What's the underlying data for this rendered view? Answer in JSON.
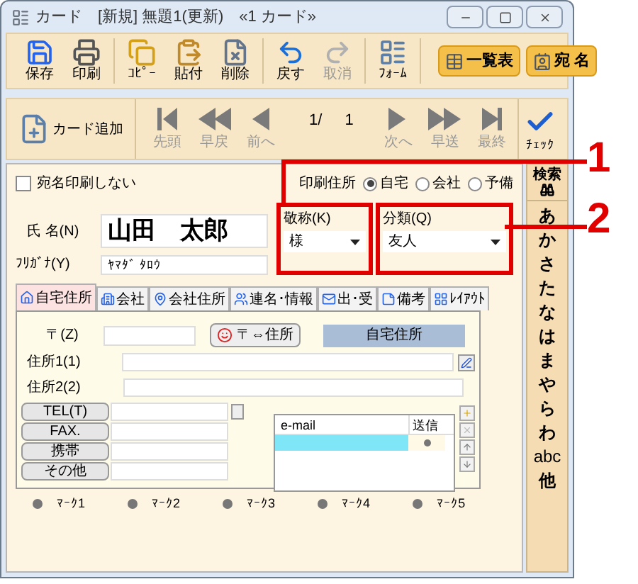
{
  "window": {
    "title": "カード　[新規] 無題1(更新)　«1 カード»"
  },
  "toolbar": {
    "groups": [
      {
        "buttons": [
          {
            "label": "保存",
            "disabled": false
          },
          {
            "label": "印刷",
            "disabled": false
          }
        ]
      },
      {
        "buttons": [
          {
            "label": "ｺﾋﾟｰ",
            "disabled": false
          },
          {
            "label": "貼付",
            "disabled": false
          },
          {
            "label": "削除",
            "disabled": false
          }
        ]
      },
      {
        "buttons": [
          {
            "label": "戻す",
            "disabled": false
          },
          {
            "label": "取消",
            "disabled": true
          }
        ]
      },
      {
        "buttons": [
          {
            "label": "ﾌｫｰﾑ",
            "disabled": false
          }
        ]
      }
    ],
    "wide_buttons": [
      {
        "label": "一覧表"
      },
      {
        "label": "宛 名"
      }
    ]
  },
  "nav": {
    "add_label": "カード追加",
    "back": [
      {
        "label": "先頭",
        "disabled": true
      },
      {
        "label": "早戻",
        "disabled": true
      },
      {
        "label": "前へ",
        "disabled": true
      }
    ],
    "current": "1/",
    "total": "1",
    "forward": [
      {
        "label": "次へ",
        "disabled": true
      },
      {
        "label": "早送",
        "disabled": true
      },
      {
        "label": "最終",
        "disabled": true
      }
    ],
    "check_label": "ﾁｪｯｸ"
  },
  "header": {
    "no_address_print": {
      "label": "宛名印刷しない",
      "checked": false
    },
    "print_address": {
      "label": "印刷住所",
      "options": [
        {
          "label": "自宅",
          "selected": true
        },
        {
          "label": "会社",
          "selected": false
        },
        {
          "label": "予備",
          "selected": false
        }
      ]
    }
  },
  "name": {
    "label": "氏 名(N)",
    "value": "山田　太郎"
  },
  "furigana": {
    "label": "ﾌﾘｶﾞﾅ(Y)",
    "value": "ﾔﾏﾀﾞ ﾀﾛｳ"
  },
  "honorific": {
    "label": "敬称(K)",
    "value": "様"
  },
  "category": {
    "label": "分類(Q)",
    "value": "友人"
  },
  "tabs": [
    {
      "label": "自宅住所",
      "selected": true
    },
    {
      "label": "会社",
      "selected": false
    },
    {
      "label": "会社住所",
      "selected": false
    },
    {
      "label": "連名･情報",
      "selected": false
    },
    {
      "label": "出･受",
      "selected": false
    },
    {
      "label": "備考",
      "selected": false
    },
    {
      "label": "ﾚｲｱｳﾄ",
      "selected": false
    }
  ],
  "address": {
    "postal_label": "〒(Z)",
    "convert_button": "〒⇔住所",
    "section_label": "自宅住所",
    "address1_label": "住所1(1)",
    "address2_label": "住所2(2)"
  },
  "phones": [
    {
      "label": "TEL(T)"
    },
    {
      "label": "FAX."
    },
    {
      "label": "携帯"
    },
    {
      "label": "その他"
    }
  ],
  "email": {
    "columns": [
      "e-mail",
      "送信"
    ],
    "rows": [
      {
        "selected": true
      }
    ],
    "side_buttons": [
      {
        "disabled": false
      },
      {
        "disabled": true
      },
      {
        "disabled": false
      },
      {
        "disabled": false
      }
    ]
  },
  "marks": [
    {
      "label": "ﾏｰｸ1"
    },
    {
      "label": "ﾏｰｸ2"
    },
    {
      "label": "ﾏｰｸ3"
    },
    {
      "label": "ﾏｰｸ4"
    },
    {
      "label": "ﾏｰｸ5"
    }
  ],
  "index": {
    "search": "検索",
    "letters": [
      "あ",
      "か",
      "さ",
      "た",
      "な",
      "は",
      "ま",
      "や",
      "ら",
      "わ",
      "abc",
      "他"
    ]
  },
  "annotations": [
    {
      "label": "1"
    },
    {
      "label": "2"
    }
  ]
}
